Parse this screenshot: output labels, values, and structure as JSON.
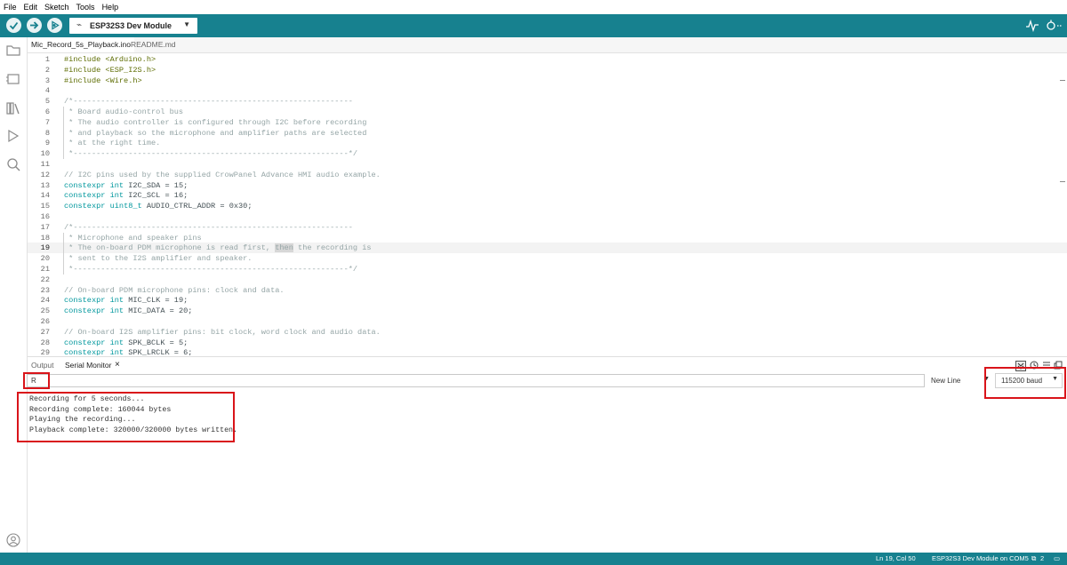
{
  "menu": [
    "File",
    "Edit",
    "Sketch",
    "Tools",
    "Help"
  ],
  "toolbar": {
    "board": "ESP32S3 Dev Module",
    "verify_icon": "checkmark-icon",
    "upload_icon": "arrow-right-icon",
    "debug_icon": "debugger-icon",
    "plotter_icon": "serial-plotter-icon",
    "monitor_icon": "serial-monitor-icon"
  },
  "sidebar": [
    "folder-icon",
    "board-manager-icon",
    "library-manager-icon",
    "debug-icon",
    "search-icon"
  ],
  "tabs": [
    "Mic_Record_5s_Playback.ino",
    "README.md"
  ],
  "code": [
    {
      "n": "1",
      "t": "#include <Arduino.h>"
    },
    {
      "n": "2",
      "t": "#include <ESP_I2S.h>"
    },
    {
      "n": "3",
      "t": "#include <Wire.h>"
    },
    {
      "n": "4",
      "t": ""
    },
    {
      "n": "5",
      "t": "/*-------------------------------------------------------------"
    },
    {
      "n": "6",
      "t": " * Board audio-control bus"
    },
    {
      "n": "7",
      "t": " * The audio controller is configured through I2C before recording"
    },
    {
      "n": "8",
      "t": " * and playback so the microphone and amplifier paths are selected"
    },
    {
      "n": "9",
      "t": " * at the right time."
    },
    {
      "n": "10",
      "t": " *------------------------------------------------------------*/"
    },
    {
      "n": "11",
      "t": ""
    },
    {
      "n": "12",
      "t": "// I2C pins used by the supplied CrowPanel Advance HMI audio example."
    },
    {
      "n": "13",
      "t": "constexpr int I2C_SDA = 15;"
    },
    {
      "n": "14",
      "t": "constexpr int I2C_SCL = 16;"
    },
    {
      "n": "15",
      "t": "constexpr uint8_t AUDIO_CTRL_ADDR = 0x30;"
    },
    {
      "n": "16",
      "t": ""
    },
    {
      "n": "17",
      "t": "/*-------------------------------------------------------------"
    },
    {
      "n": "18",
      "t": " * Microphone and speaker pins"
    },
    {
      "n": "19",
      "t": " * The on-board PDM microphone is read first, then the recording is"
    },
    {
      "n": "20",
      "t": " * sent to the I2S amplifier and speaker."
    },
    {
      "n": "21",
      "t": " *------------------------------------------------------------*/"
    },
    {
      "n": "22",
      "t": ""
    },
    {
      "n": "23",
      "t": "// On-board PDM microphone pins: clock and data."
    },
    {
      "n": "24",
      "t": "constexpr int MIC_CLK = 19;"
    },
    {
      "n": "25",
      "t": "constexpr int MIC_DATA = 20;"
    },
    {
      "n": "26",
      "t": ""
    },
    {
      "n": "27",
      "t": "// On-board I2S amplifier pins: bit clock, word clock and audio data."
    },
    {
      "n": "28",
      "t": "constexpr int SPK_BCLK = 5;"
    },
    {
      "n": "29",
      "t": "constexpr int SPK_LRCLK = 6;"
    }
  ],
  "panel": {
    "tabs": [
      "Output",
      "Serial Monitor"
    ],
    "close": "×",
    "input_value": "R",
    "line_ending": "New Line",
    "baud": "115200 baud",
    "output": [
      "Recording for 5 seconds...",
      "Recording complete: 160044 bytes",
      "Playing the recording...",
      "Playback complete: 320000/320000 bytes written."
    ]
  },
  "status": {
    "position": "Ln 19, Col 50",
    "board_port": "ESP32S3 Dev Module on COM5",
    "notifications": "2"
  },
  "colors": {
    "toolbar": "#17818f",
    "annotation": "#d9141a",
    "keyword": "#00979d",
    "preprocessor": "#5e6d03",
    "comment": "#95a5a6"
  }
}
